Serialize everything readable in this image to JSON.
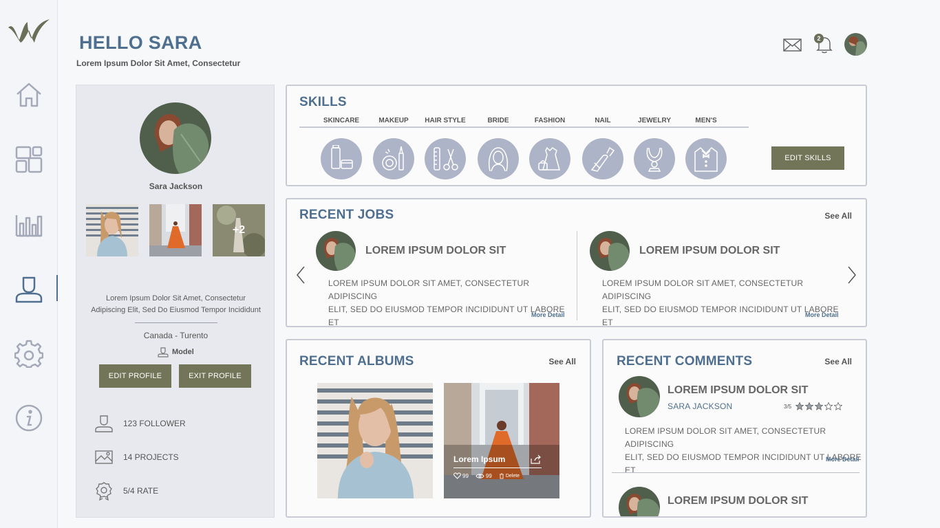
{
  "header": {
    "greeting": "HELLO SARA",
    "subtitle": "Lorem Ipsum Dolor Sit Amet, Consectetur",
    "notification_count": "2"
  },
  "nav": [
    "home-icon",
    "dashboard-icon",
    "analytics-icon",
    "profile-icon",
    "settings-icon",
    "info-icon"
  ],
  "profile": {
    "name": "Sara Jackson",
    "more_photos": "+2",
    "bio_line1": "Lorem Ipsum Dolor Sit Amet, Consectetur",
    "bio_line2": "Adipiscing Elit, Sed Do Eiusmod Tempor Incididunt",
    "location": "Canada - Turento",
    "role": "Model",
    "edit_label": "EDIT PROFILE",
    "exit_label": "EXIT PROFILE",
    "stats": {
      "followers": "123 FOLLOWER",
      "projects": "14 PROJECTS",
      "rate": "5/4 RATE"
    }
  },
  "skills": {
    "title": "SKILLS",
    "items": [
      "SKINCARE",
      "MAKEUP",
      "HAIR STYLE",
      "BRIDE",
      "FASHION",
      "NAIL",
      "JEWELRY",
      "MEN'S"
    ],
    "edit_label": "EDIT SKILLS"
  },
  "jobs": {
    "title": "RECENT JOBS",
    "see_all": "See All",
    "items": [
      {
        "title": "LOREM IPSUM DOLOR SIT",
        "line1": "LOREM IPSUM DOLOR SIT AMET, CONSECTETUR ADIPISCING",
        "line2": "ELIT, SED DO EIUSMOD TEMPOR INCIDIDUNT UT LABORE ET",
        "more": "More Detail"
      },
      {
        "title": "LOREM IPSUM DOLOR SIT",
        "line1": "LOREM IPSUM DOLOR SIT AMET, CONSECTETUR ADIPISCING",
        "line2": "ELIT, SED DO EIUSMOD TEMPOR INCIDIDUNT UT LABORE ET",
        "more": "More Detail"
      }
    ]
  },
  "albums": {
    "title": "RECENT ALBUMS",
    "see_all": "See All",
    "featured": {
      "title": "Lorem Ipsum",
      "likes": "99",
      "views": "99",
      "delete_label": "Delete"
    }
  },
  "comments": {
    "title": "RECENT COMMENTS",
    "see_all": "See All",
    "items": [
      {
        "title": "LOREM IPSUM DOLOR SIT",
        "author": "SARA JACKSON",
        "rating_text": "3/5",
        "rating": 3,
        "line1": "LOREM IPSUM DOLOR SIT AMET, CONSECTETUR ADIPISCING",
        "line2": "ELIT, SED DO EIUSMOD TEMPOR INCIDIDUNT UT LABORE ET",
        "more": "More Detail"
      },
      {
        "title": "LOREM IPSUM DOLOR SIT"
      }
    ]
  },
  "colors": {
    "accent": "#4e6f8f",
    "olive": "#737558",
    "skill_circle": "#aeb4c7"
  }
}
